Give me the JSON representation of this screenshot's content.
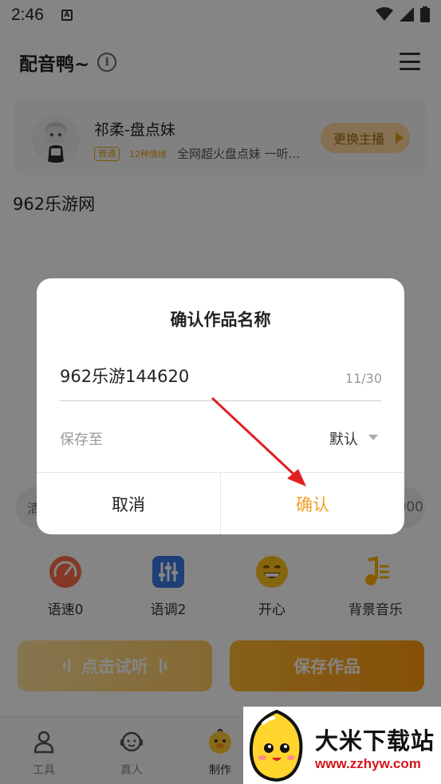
{
  "status": {
    "time": "2:46"
  },
  "header": {
    "title": "配音鸭~",
    "info_icon": "info-icon",
    "menu_icon": "menu-icon"
  },
  "anchor": {
    "name": "祁柔-盘点妹",
    "badge": "普通",
    "emotions": "12种情绪",
    "description": "全网超火盘点妹 一听...",
    "change_label": "更换主播"
  },
  "editor": {
    "text": "962乐游网"
  },
  "bg_strip": {
    "left": "清",
    "right": "000"
  },
  "tools": [
    {
      "label": "语速0",
      "icon": "speed-gauge-icon"
    },
    {
      "label": "语调2",
      "icon": "pitch-sliders-icon"
    },
    {
      "label": "开心",
      "icon": "happy-face-icon"
    },
    {
      "label": "背景音乐",
      "icon": "music-note-icon"
    }
  ],
  "actions": {
    "listen_label": "点击试听",
    "save_label": "保存作品"
  },
  "tabs": [
    {
      "label": "工具",
      "icon": "tools-person-icon"
    },
    {
      "label": "真人",
      "icon": "headset-icon"
    },
    {
      "label": "制作",
      "icon": "duck-icon"
    }
  ],
  "dialog": {
    "title": "确认作品名称",
    "name_value": "962乐游144620",
    "name_count": "11/30",
    "save_to_label": "保存至",
    "save_to_value": "默认",
    "cancel_label": "取消",
    "confirm_label": "确认"
  },
  "watermark": {
    "title": "大米下载站",
    "url": "www.zzhyw.com"
  },
  "colors": {
    "accent": "#f0a028",
    "save_button": "#ff9a12",
    "arrow": "#e02020"
  }
}
